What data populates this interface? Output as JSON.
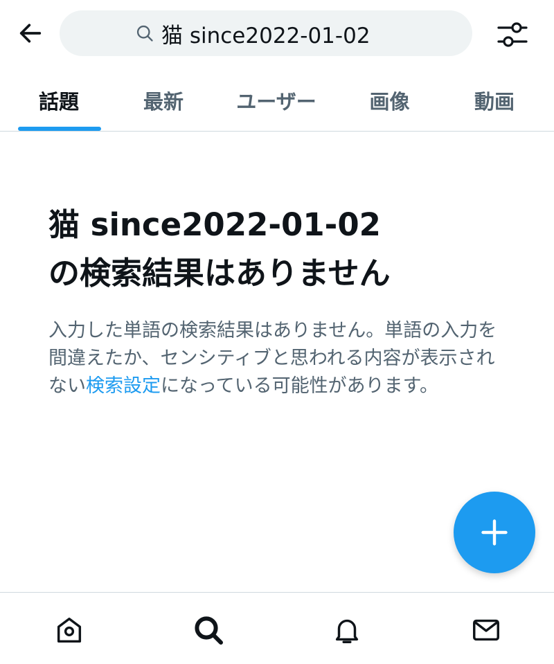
{
  "header": {
    "search_value": "猫 since2022-01-02",
    "back_icon": "arrow-left-icon",
    "search_icon": "search-icon",
    "filter_icon": "sliders-icon"
  },
  "tabs": [
    {
      "label": "話題",
      "active": true
    },
    {
      "label": "最新",
      "active": false
    },
    {
      "label": "ユーザー",
      "active": false
    },
    {
      "label": "画像",
      "active": false
    },
    {
      "label": "動画",
      "active": false
    }
  ],
  "empty_state": {
    "title_line1": "猫 since2022-01-02",
    "title_line2": "の検索結果はありません",
    "desc_before": "入力した単語の検索結果はありません。単語の入力を間違えたか、センシティブと思われる内容が表示されない",
    "desc_link": "検索設定",
    "desc_after": "になっている可能性があります。"
  },
  "fab": {
    "icon": "plus-icon"
  },
  "bottom_nav": [
    {
      "name": "home",
      "icon": "home-icon"
    },
    {
      "name": "search",
      "icon": "search-icon"
    },
    {
      "name": "notifications",
      "icon": "bell-icon"
    },
    {
      "name": "messages",
      "icon": "mail-icon"
    }
  ],
  "colors": {
    "accent": "#1d9bf0",
    "text_primary": "#0f1419",
    "text_secondary": "#536471",
    "search_bg": "#eff3f4",
    "divider": "#cfd9de"
  }
}
